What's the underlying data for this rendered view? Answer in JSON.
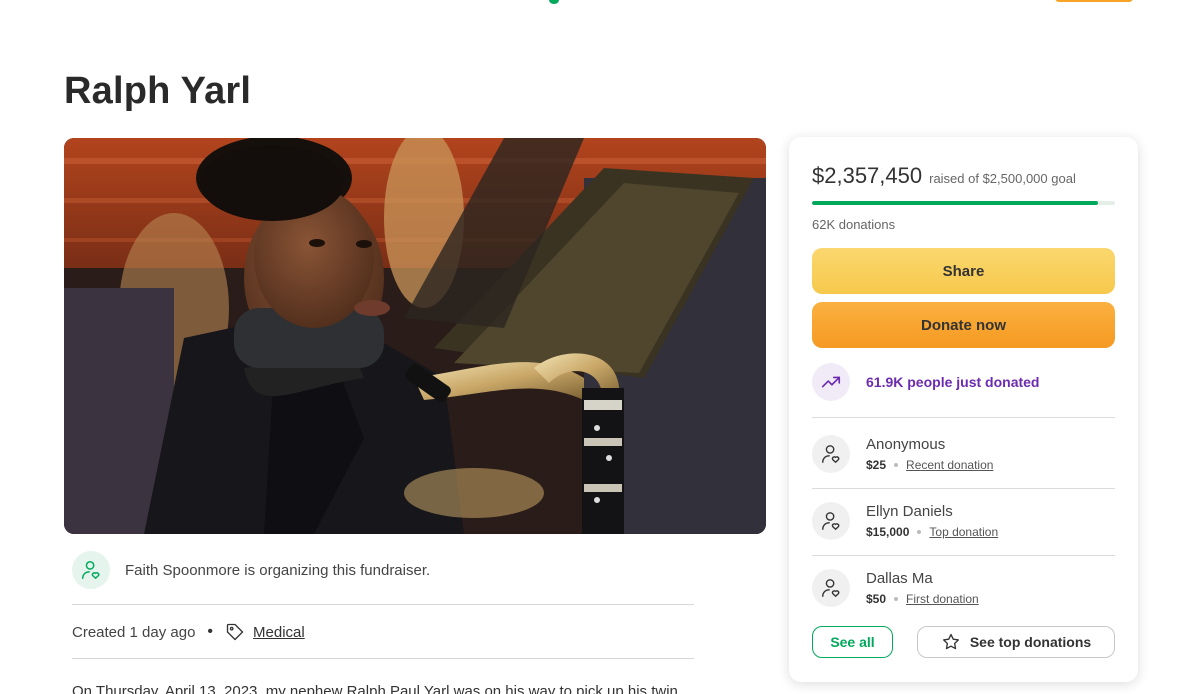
{
  "page": {
    "title": "Ralph Yarl"
  },
  "hero_image": {
    "icon": "portrait-photo"
  },
  "organizer": {
    "text": "Faith Spoonmore is organizing this fundraiser.",
    "icon": "person-heart-icon"
  },
  "meta": {
    "created": "Created 1 day ago",
    "separator": "•",
    "category": "Medical",
    "category_icon": "tag-icon"
  },
  "story": {
    "first_line": "On Thursday, April 13, 2023, my nephew Ralph Paul Yarl was on his way to pick up his twin"
  },
  "campaign": {
    "raised": "$2,357,450",
    "goal_text": "raised of $2,500,000 goal",
    "progress_fraction": 0.943,
    "donations": "62K donations"
  },
  "actions": {
    "share": "Share",
    "donate": "Donate now",
    "see_all": "See all",
    "see_top": "See top donations"
  },
  "trend": {
    "text": "61.9K people just donated",
    "icon": "trending-up-icon"
  },
  "donors": [
    {
      "name": "Anonymous",
      "amount": "$25",
      "type": "Recent donation"
    },
    {
      "name": "Ellyn Daniels",
      "amount": "$15,000",
      "type": "Top donation"
    },
    {
      "name": "Dallas Ma",
      "amount": "$50",
      "type": "First donation"
    }
  ],
  "colors": {
    "brand_green": "#02a95c",
    "share_yellow": "#f6c94b",
    "donate_orange": "#f59a22",
    "trend_purple": "#6c2bb0"
  }
}
